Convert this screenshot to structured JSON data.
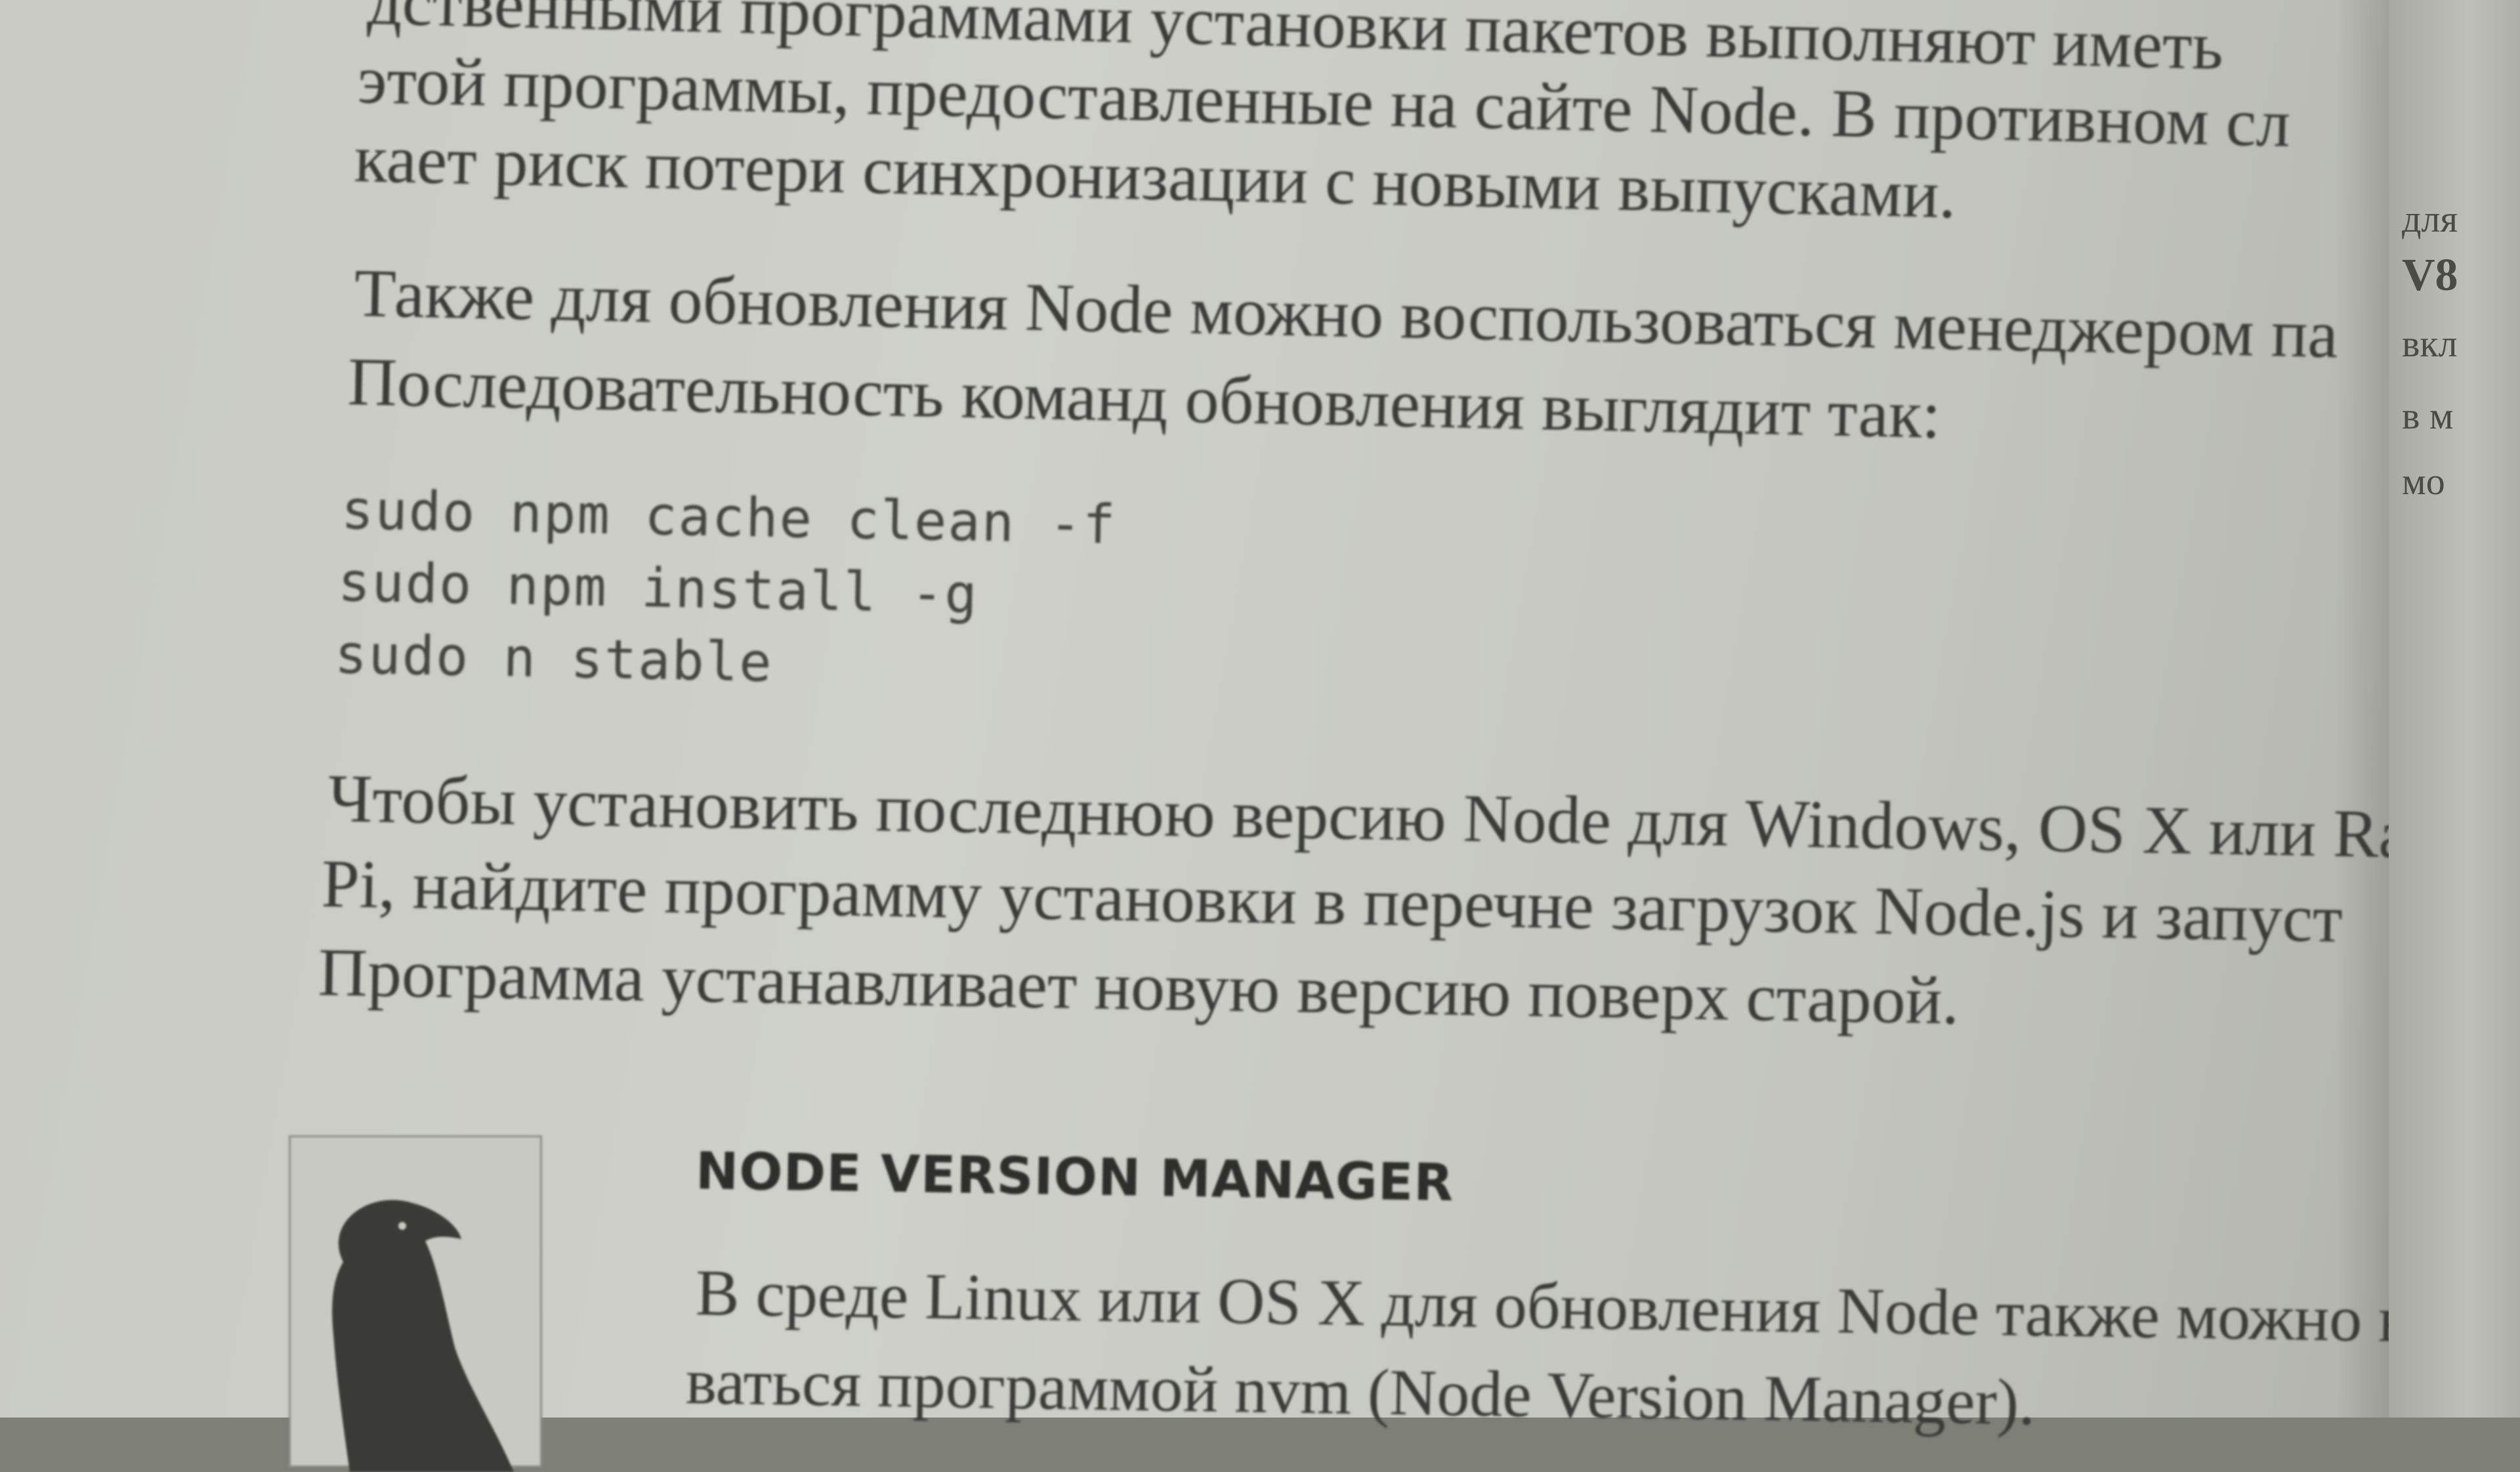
{
  "paragraphs": {
    "top": [
      "дственными программами установки пакетов выполняют иметь",
      "этой программы, предоставленные на сайте Node. В противном сл",
      "кает риск потери синхронизации с новыми выпусками."
    ],
    "second": [
      "Также для обновления Node можно воспользоваться менеджером па",
      "Последовательность команд обновления выглядит так:"
    ],
    "third": [
      "Чтобы установить последнюю версию Node для Windows, OS X или Ras",
      "Pi, найдите программу установки в перечне загрузок Node.js и запуст",
      "Программа устанавливает новую версию поверх старой."
    ]
  },
  "code_lines": [
    "sudo npm cache clean -f",
    "sudo npm install -g",
    "sudo n stable"
  ],
  "note": {
    "title": "NODE VERSION MANAGER",
    "lines": [
      "В среде Linux или OS X для обновления Node также можно вос",
      "ваться программой nvm (Node Version Manager)."
    ]
  },
  "next_page_fragments": [
    "для",
    "V8",
    "вкл",
    "в м",
    "мо"
  ],
  "colors": {
    "page": "#cfd0ca",
    "text": "#3b3b38",
    "code": "#464642",
    "logo": "#3a3b37"
  },
  "logo_icon": "crow-icon"
}
